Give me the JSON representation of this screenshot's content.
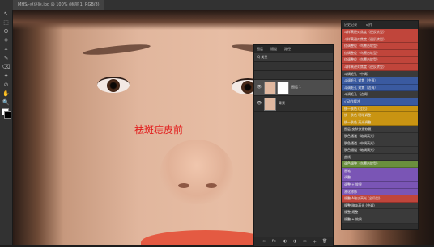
{
  "document_tab": "MHS/-点评后.jpg @ 100% (图层 1, RGB/8)",
  "overlay_label": "祛斑痣皮前",
  "tools": [
    "↖",
    "⬚",
    "ʘ",
    "✥",
    "⌗",
    "✎",
    "⌫",
    "✦",
    "⊘",
    "✋",
    "🔍"
  ],
  "layers_panel": {
    "tabs": [
      "图层",
      "通道",
      "路径"
    ],
    "filter_label": "Q 类型",
    "layers": [
      {
        "name": "图层 1",
        "selected": true
      },
      {
        "name": "背景",
        "selected": false
      }
    ],
    "bottom_icons": [
      "∞",
      "fx",
      "◐",
      "◑",
      "▭",
      "＋",
      "🗑"
    ]
  },
  "history_panel": {
    "tabs": [
      "历史记录",
      "动作"
    ],
    "items": [
      {
        "text": "斗样黄逊对焦度（逆反转型）",
        "color": "#c0453b"
      },
      {
        "text": "斗样黄逊对焦度（逆反转型）",
        "color": "#c0453b"
      },
      {
        "text": "红调整位（鸟覆台转型）",
        "color": "#c0453b"
      },
      {
        "text": "红调整位（鸟覆台转型）",
        "color": "#c0453b"
      },
      {
        "text": "红调整位（鸟覆台转型）",
        "color": "#c0453b"
      },
      {
        "text": "斗样黄逊对焦度（逆反转型）",
        "color": "#c0453b"
      },
      {
        "text": "斗调毛孔（中调）",
        "color": "#3a3a3a"
      },
      {
        "text": "斗调毛孔 对焦（中调）",
        "color": "#3a5aa0"
      },
      {
        "text": "斗调毛孔 对焦（边调）",
        "color": "#3a5aa0"
      },
      {
        "text": "斗调毛孔（边调）",
        "color": "#3a3a3a"
      },
      {
        "text": "√ 动作缓冲",
        "color": "#3a5aa0"
      },
      {
        "text": "统一肤色 (过后)",
        "color": "#c99412"
      },
      {
        "text": "统一肤色 明暗调整",
        "color": "#c99412"
      },
      {
        "text": "统一肤色 高光调整",
        "color": "#c99412"
      },
      {
        "text": "图层-皮肤快速修复",
        "color": "#3a3a3a"
      },
      {
        "text": "肤色通道（暗调高光）",
        "color": "#3a3a3a"
      },
      {
        "text": "肤色通道（中调高光）",
        "color": "#3a3a3a"
      },
      {
        "text": "肤色通道（暗调高光）",
        "color": "#3a3a3a"
      },
      {
        "text": "曲线",
        "color": "#3a3a3a"
      },
      {
        "text": "调色调整（鸟覆台转型）",
        "color": "#6a8f3d"
      },
      {
        "text": "画笔",
        "color": "#7a55b5"
      },
      {
        "text": "调整",
        "color": "#7a55b5"
      },
      {
        "text": "调整 + 效果",
        "color": "#7a55b5"
      },
      {
        "text": "液化修饰",
        "color": "#7a55b5"
      },
      {
        "text": "规整 A暗淡高光 (全局型)",
        "color": "#c0453b"
      },
      {
        "text": "规整 暗淡高光 (中调)",
        "color": "#3a3a3a"
      },
      {
        "text": "规整 规整",
        "color": "#3a3a3a"
      },
      {
        "text": "规整 + 效果",
        "color": "#3a3a3a"
      }
    ]
  }
}
